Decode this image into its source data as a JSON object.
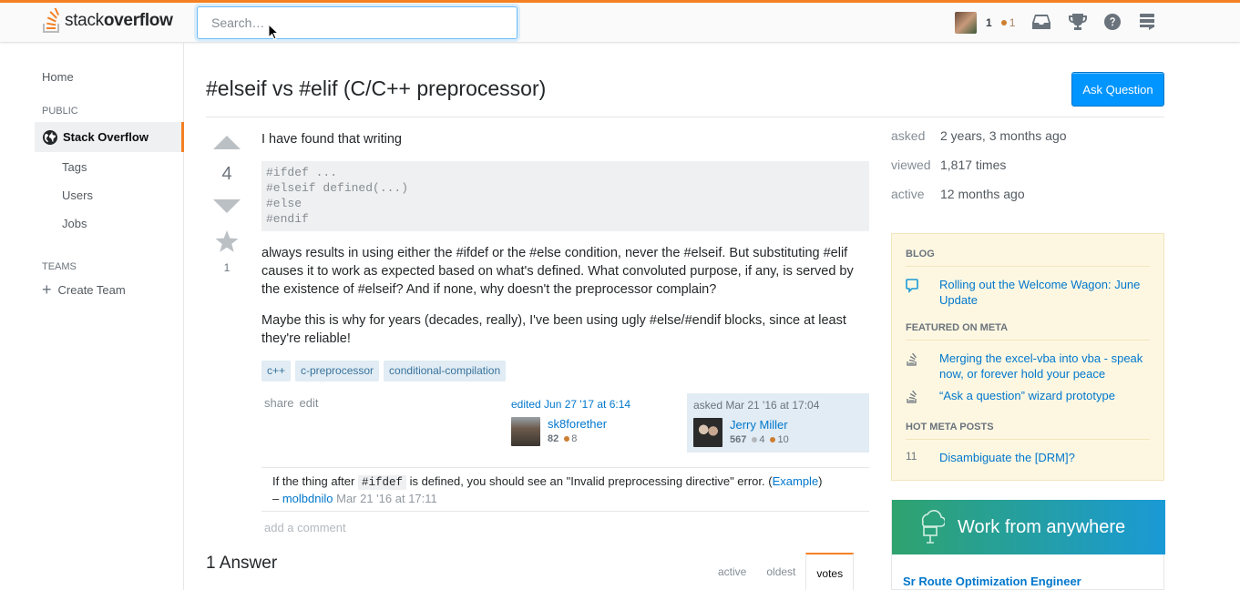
{
  "header": {
    "logo_text_light": "stack",
    "logo_text_bold": "overflow",
    "search_placeholder": "Search…",
    "reputation": "1",
    "bronze_badges": "1"
  },
  "nav": {
    "home": "Home",
    "public_heading": "PUBLIC",
    "stack_overflow": "Stack Overflow",
    "tags": "Tags",
    "users": "Users",
    "jobs": "Jobs",
    "teams_heading": "TEAMS",
    "create_team": "Create Team"
  },
  "question": {
    "title": "#elseif vs #elif (C/C++ preprocessor)",
    "ask_button": "Ask Question",
    "votes": "4",
    "favorites": "1",
    "intro": "I have found that writing",
    "code": [
      "#ifdef ...",
      "#elseif defined(...)",
      "#else",
      "#endif"
    ],
    "para1": "always results in using either the #ifdef or the #else condition, never the #elseif. But substituting #elif causes it to work as expected based on what's defined. What convoluted purpose, if any, is served by the existence of #elseif? And if none, why doesn't the preprocessor complain?",
    "para2": "Maybe this is why for years (decades, really), I've been using ugly #else/#endif blocks, since at least they're reliable!",
    "tags": [
      "c++",
      "c-preprocessor",
      "conditional-compilation"
    ],
    "share": "share",
    "edit": "edit",
    "edited_label": "edited Jun 27 '17 at 6:14",
    "editor": {
      "name": "sk8forether",
      "rep": "82",
      "bronze": "8"
    },
    "asked_label": "asked Mar 21 '16 at 17:04",
    "author": {
      "name": "Jerry Miller",
      "rep": "567",
      "silver": "4",
      "bronze": "10"
    }
  },
  "comment": {
    "text_before": "If the thing after ",
    "code": "#ifdef",
    "text_after": " is defined, you should see an \"Invalid preprocessing directive\" error. (",
    "link": "Example",
    "close": ")",
    "dash": "– ",
    "user": "molbdnilo",
    "time": " Mar 21 '16 at 17:11"
  },
  "add_comment": "add a comment",
  "answers": {
    "heading": "1 Answer",
    "tabs": [
      "active",
      "oldest",
      "votes"
    ],
    "selected_tab": "votes"
  },
  "stats": {
    "asked_k": "asked",
    "asked_v": "2 years, 3 months ago",
    "viewed_k": "viewed",
    "viewed_v": "1,817 times",
    "active_k": "active",
    "active_v": "12 months ago"
  },
  "sidebar": {
    "blog_heading": "BLOG",
    "blog_item": "Rolling out the Welcome Wagon: June Update",
    "meta_heading": "FEATURED ON META",
    "meta_items": [
      "Merging the excel-vba into vba - speak now, or forever hold your peace",
      "“Ask a question” wizard prototype"
    ],
    "hot_heading": "HOT META POSTS",
    "hot_count": "11",
    "hot_item": "Disambiguate the [DRM]?",
    "ad_banner": "Work from anywhere",
    "ad_job": "Sr Route Optimization Engineer"
  },
  "colors": {
    "accent": "#f48024",
    "link": "#0077cc",
    "button": "#0095ff",
    "tag_bg": "#e1ecf4",
    "sidebar_bg": "#fdf7e2"
  }
}
